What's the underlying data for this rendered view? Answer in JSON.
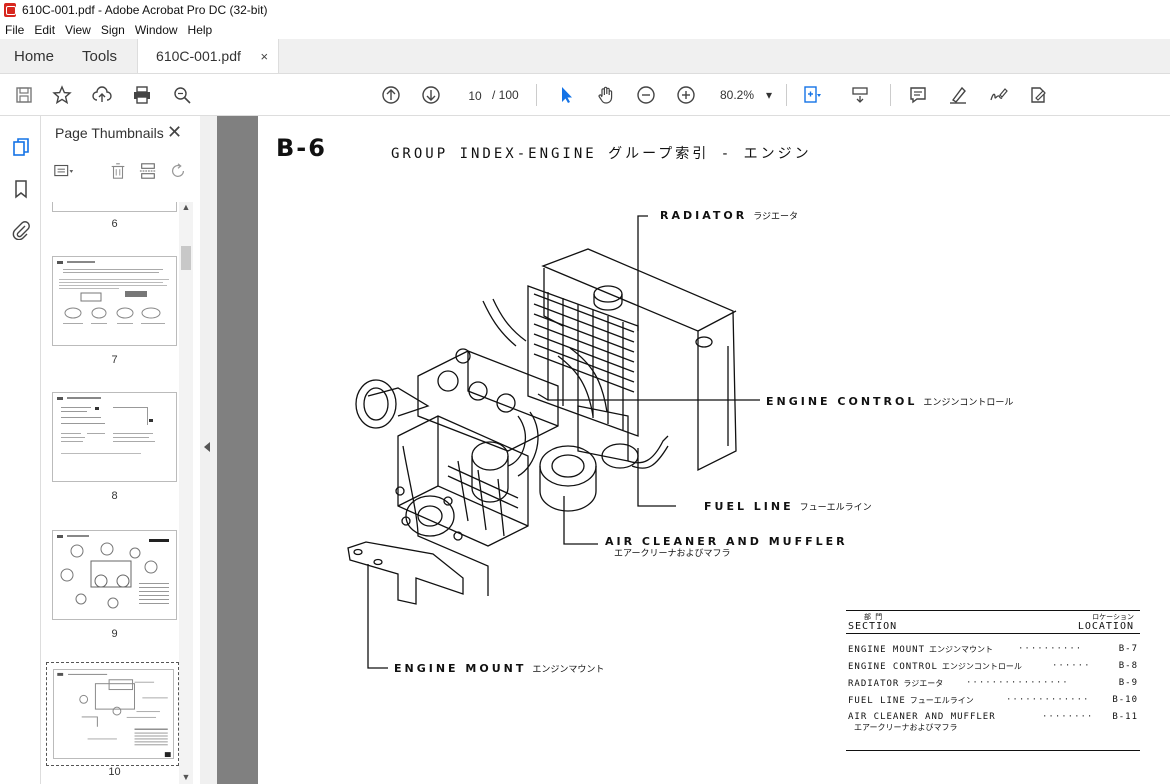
{
  "window": {
    "title": "610C-001.pdf - Adobe Acrobat Pro DC (32-bit)"
  },
  "menu": [
    "File",
    "Edit",
    "View",
    "Sign",
    "Window",
    "Help"
  ],
  "tabs": {
    "home": "Home",
    "tools": "Tools",
    "document": "610C-001.pdf",
    "close": "×"
  },
  "toolbar": {
    "page_current": "10",
    "page_total": "/ 100",
    "zoom": "80.2%",
    "zoom_arrow": "▾"
  },
  "thumbnails": {
    "title": "Page Thumbnails",
    "close": "✕",
    "pages": [
      "6",
      "7",
      "8",
      "9",
      "10"
    ]
  },
  "page": {
    "title": "B-6",
    "subtitle": "GROUP INDEX-ENGINE グループ索引 - エンジン",
    "callouts": {
      "radiator": {
        "en": "RADIATOR",
        "jp": "ラジエータ"
      },
      "engine_control": {
        "en": "ENGINE CONTROL",
        "jp": "エンジンコントロール"
      },
      "fuel_line": {
        "en": "FUEL LINE",
        "jp": "フューエルライン"
      },
      "air_cleaner": {
        "en": "AIR CLEANER AND MUFFLER",
        "jp": "エアークリーナおよびマフラ"
      },
      "engine_mount": {
        "en": "ENGINE MOUNT",
        "jp": "エンジンマウント"
      }
    },
    "table": {
      "section_jp": "部 門",
      "section": "SECTION",
      "location_jp": "ロケーション",
      "location": "LOCATION",
      "rows": [
        {
          "section": "ENGINE MOUNT",
          "jp": "エンジンマウント",
          "dots": "··········",
          "loc": "B-7"
        },
        {
          "section": "ENGINE CONTROL",
          "jp": "エンジンコントロール",
          "dots": "······",
          "loc": "B-8"
        },
        {
          "section": "RADIATOR",
          "jp": "ラジエータ",
          "dots": "················",
          "loc": "B-9"
        },
        {
          "section": "FUEL LINE",
          "jp": "フューエルライン",
          "dots": "·············",
          "loc": "B-10"
        },
        {
          "section": "AIR CLEANER AND MUFFLER",
          "jp": "",
          "dots": "········",
          "loc": "B-11",
          "sub": "エアークリーナおよびマフラ"
        }
      ]
    }
  }
}
